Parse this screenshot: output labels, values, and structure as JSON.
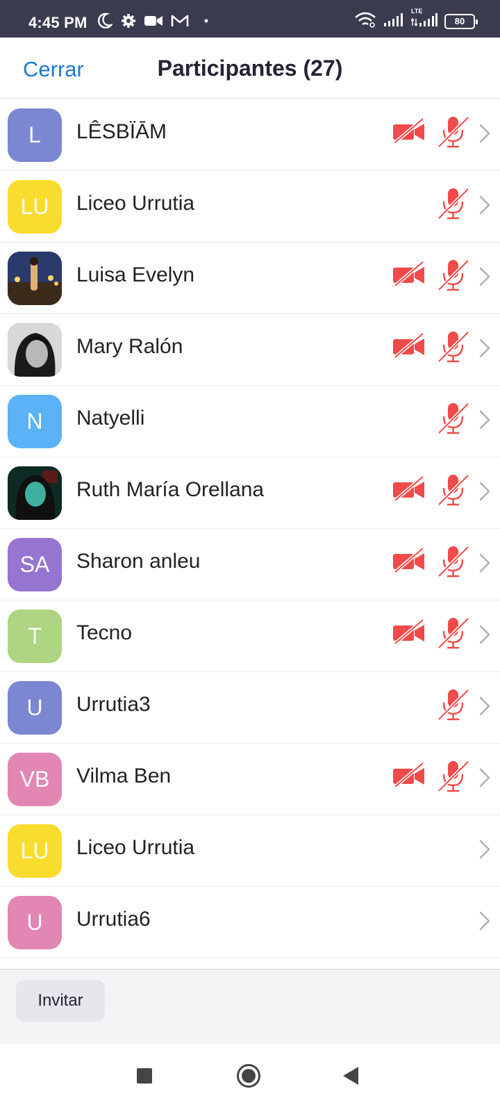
{
  "status_bar": {
    "time": "4:45 PM",
    "left_icons": [
      "moon-icon",
      "gear-icon",
      "video-icon",
      "gmail-icon",
      "dot-icon"
    ],
    "right_icons": [
      "wifi-icon",
      "signal-icon",
      "lte-signal-icon",
      "battery-icon"
    ],
    "lte_label": "LTE",
    "battery": "80",
    "bar_color": "#3b3b50"
  },
  "header": {
    "close_label": "Cerrar",
    "title": "Participantes (27)",
    "accent_color": "#1f78d1"
  },
  "participants": [
    {
      "name": "LÊSBÏĀM",
      "initials": "L",
      "avatar_color": "#7b87d0",
      "avatar_type": "initials",
      "video_off": true,
      "muted": true
    },
    {
      "name": "Liceo Urrutia",
      "initials": "LU",
      "avatar_color": "#f9dd2e",
      "avatar_type": "initials",
      "video_off": false,
      "muted": true
    },
    {
      "name": "Luisa Evelyn",
      "initials": "",
      "avatar_color": "#2a3a6a",
      "avatar_type": "photo",
      "video_off": true,
      "muted": true
    },
    {
      "name": "Mary Ralón",
      "initials": "",
      "avatar_color": "#3a3a3a",
      "avatar_type": "photo",
      "video_off": true,
      "muted": true
    },
    {
      "name": "Natyelli",
      "initials": "N",
      "avatar_color": "#5bb2f7",
      "avatar_type": "initials",
      "video_off": false,
      "muted": true
    },
    {
      "name": "Ruth María Orellana",
      "initials": "",
      "avatar_color": "#0d2a24",
      "avatar_type": "photo",
      "video_off": true,
      "muted": true
    },
    {
      "name": "Sharon anleu",
      "initials": "SA",
      "avatar_color": "#9575d0",
      "avatar_type": "initials",
      "video_off": true,
      "muted": true
    },
    {
      "name": "Tecno",
      "initials": "T",
      "avatar_color": "#aed581",
      "avatar_type": "initials",
      "video_off": true,
      "muted": true
    },
    {
      "name": "Urrutia3",
      "initials": "U",
      "avatar_color": "#7b87d0",
      "avatar_type": "initials",
      "video_off": false,
      "muted": true
    },
    {
      "name": "Vilma Ben",
      "initials": "VB",
      "avatar_color": "#e286b4",
      "avatar_type": "initials",
      "video_off": true,
      "muted": true
    },
    {
      "name": "Liceo Urrutia",
      "initials": "LU",
      "avatar_color": "#f9dd2e",
      "avatar_type": "initials",
      "video_off": false,
      "muted": false
    },
    {
      "name": "Urrutia6",
      "initials": "U",
      "avatar_color": "#e286b4",
      "avatar_type": "initials",
      "video_off": false,
      "muted": false
    }
  ],
  "status_color": "#f04a4a",
  "footer": {
    "invite_label": "Invitar"
  },
  "nav_bar": {
    "buttons": [
      "recents-square-icon",
      "home-circle-icon",
      "back-triangle-icon"
    ]
  }
}
